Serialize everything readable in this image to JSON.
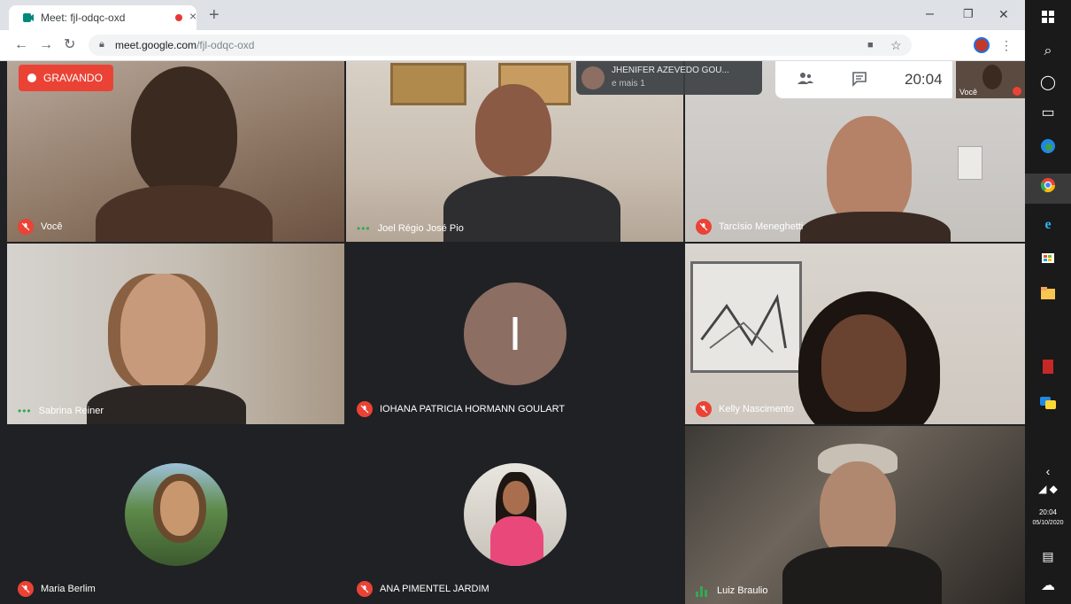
{
  "browser": {
    "tab_title": "Meet: fjl-odqc-oxd",
    "new_tab_symbol": "+",
    "tab_close_symbol": "×",
    "window_minimize": "–",
    "window_restore": "❐",
    "window_close": "✕",
    "url_host": "meet.google.com",
    "url_path": "/fjl-odqc-oxd"
  },
  "meet": {
    "recording_label": "GRAVANDO",
    "presenter_name": "JHENIFER AZEVEDO GOU...",
    "presenter_more": "e mais 1",
    "clock": "20:04",
    "self_thumb_label": "Você",
    "participants": [
      {
        "name": "Você",
        "status": "muted"
      },
      {
        "name": "Joel Régio José Pio",
        "status": "dots"
      },
      {
        "name": "Tarcísio Meneghetti",
        "status": "muted"
      },
      {
        "name": "Sabrina Reiner",
        "status": "dots"
      },
      {
        "name": "IOHANA PATRICIA HORMANN GOULART",
        "status": "muted",
        "initial": "I"
      },
      {
        "name": "Kelly Nascimento",
        "status": "muted"
      },
      {
        "name": "Maria Berlim",
        "status": "muted"
      },
      {
        "name": "ANA PIMENTEL JARDIM",
        "status": "muted"
      },
      {
        "name": "Luiz Braulio",
        "status": "speaking"
      }
    ]
  },
  "taskbar": {
    "time": "20:04",
    "date": "05/10/2020"
  },
  "colors": {
    "mute_red": "#ea4335",
    "meet_bg": "#202124",
    "initial_avatar": "#8d6e63",
    "speaking_green": "#34a853"
  }
}
